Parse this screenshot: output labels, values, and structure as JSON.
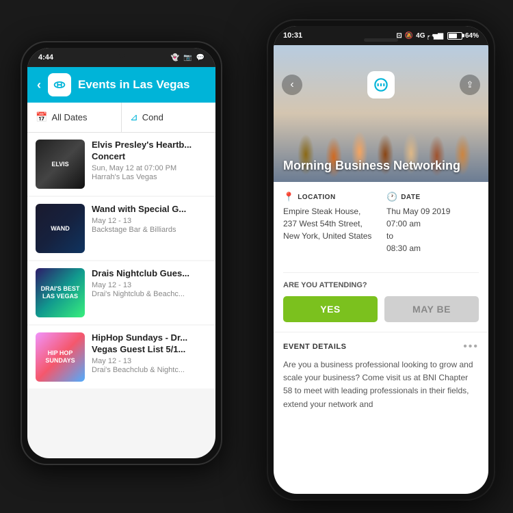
{
  "scene": {
    "background": "#1a1a1a"
  },
  "phone_back": {
    "status_bar": {
      "time": "4:44",
      "icons": [
        "snapchat",
        "instagram",
        "message"
      ]
    },
    "header": {
      "title": "Events in Las Vegas",
      "back_arrow": "‹"
    },
    "filter_bar": {
      "left_label": "All Dates",
      "right_label": "Cond"
    },
    "events": [
      {
        "name": "Elvis Presley's Heartb... Concert",
        "date": "Sun, May 12 at 07:00 PM",
        "venue": "Harrah's Las Vegas",
        "thumb_type": "elvis"
      },
      {
        "name": "Wand with Special G...",
        "date": "May 12 - 13",
        "venue": "Backstage Bar & Billiards",
        "thumb_type": "wand"
      },
      {
        "name": "Drais Nightclub Gues...",
        "date": "May 12 - 13",
        "venue": "Drai's Nightclub & Beachc...",
        "thumb_type": "drais"
      },
      {
        "name": "HipHop Sundays - Dr... Vegas Guest List 5/1...",
        "date": "May 12 - 13",
        "venue": "Drai's Beachclub & Nightc...",
        "thumb_type": "hiphop"
      }
    ]
  },
  "phone_front": {
    "status_bar": {
      "time": "10:31",
      "notifications_off": true,
      "signal": "4G",
      "battery_percent": "64%"
    },
    "event": {
      "title": "Morning Business Networking",
      "back_button": "‹",
      "share_button": "⇪"
    },
    "location": {
      "label": "LOCATION",
      "value": "Empire Steak House, 237 West 54th Street, New York, United States"
    },
    "date": {
      "label": "DATE",
      "value_line1": "Thu May 09 2019",
      "value_line2": "07:00 am",
      "value_line3": "to",
      "value_line4": "08:30 am"
    },
    "attending": {
      "question": "ARE YOU ATTENDING?",
      "yes_label": "YES",
      "maybe_label": "MAY BE"
    },
    "event_details": {
      "label": "EVENT DETAILS",
      "description": "Are you a business professional looking to grow and scale your business? Come visit us at BNI Chapter 58 to meet with leading professionals in their fields, extend your network and"
    }
  }
}
